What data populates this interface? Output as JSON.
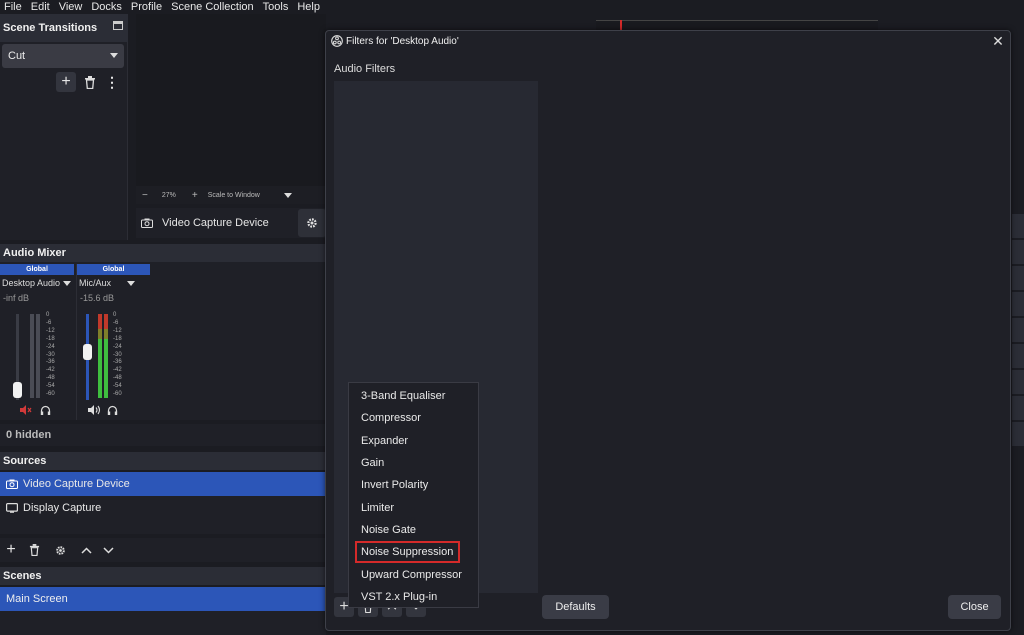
{
  "menubar": {
    "items": [
      "File",
      "Edit",
      "View",
      "Docks",
      "Profile",
      "Scene Collection",
      "Tools",
      "Help"
    ]
  },
  "transitions": {
    "title": "Scene Transitions",
    "selected": "Cut"
  },
  "preview": {
    "zoom": "27%",
    "scale_mode": "Scale to Window",
    "source_name": "Video Capture Device"
  },
  "mixer": {
    "title": "Audio Mixer",
    "channels": [
      {
        "global": "Global",
        "name": "Desktop Audio",
        "db": "-inf dB",
        "muted": true,
        "level": 0
      },
      {
        "global": "Global",
        "name": "Mic/Aux",
        "db": "-15.6 dB",
        "muted": false,
        "level": 0.55
      }
    ],
    "scale": [
      "0",
      "-6",
      "-12",
      "-18",
      "-24",
      "-30",
      "-36",
      "-42",
      "-48",
      "-54",
      "-60"
    ],
    "hidden_label": "0 hidden"
  },
  "sources": {
    "title": "Sources",
    "items": [
      "Video Capture Device",
      "Display Capture"
    ]
  },
  "scenes": {
    "title": "Scenes",
    "items": [
      "Main Screen"
    ]
  },
  "dialog": {
    "title": "Filters for 'Desktop Audio'",
    "section_label": "Audio Filters",
    "defaults_label": "Defaults",
    "close_label": "Close"
  },
  "context_menu": {
    "items": [
      "3-Band Equaliser",
      "Compressor",
      "Expander",
      "Gain",
      "Invert Polarity",
      "Limiter",
      "Noise Gate",
      "Noise Suppression",
      "Upward Compressor",
      "VST 2.x Plug-in"
    ],
    "highlighted": "Noise Suppression"
  },
  "colors": {
    "accent": "#2c56b8",
    "highlight_border": "#d42a2a",
    "meter_green": "#3fbf3f",
    "meter_red": "#c0392b"
  }
}
